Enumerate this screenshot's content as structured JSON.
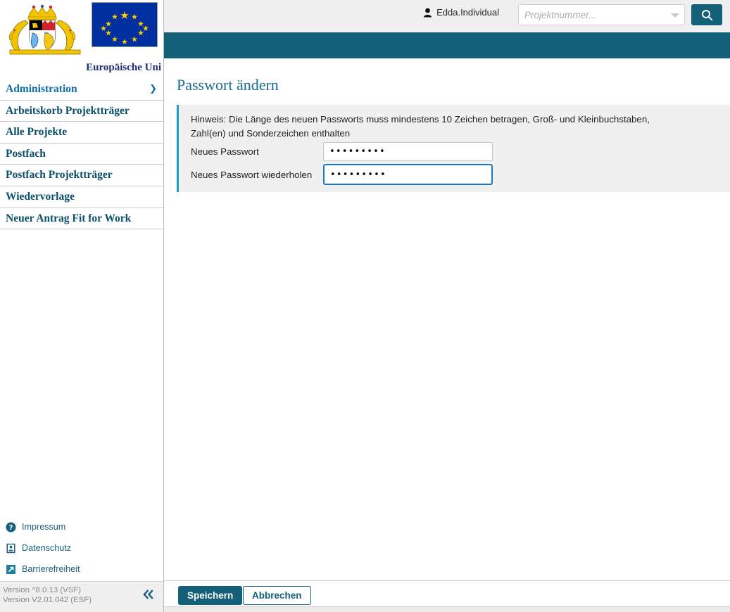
{
  "branding": {
    "bavaria_logo_alt": "bavaria-coat-of-arms",
    "eu_flag_alt": "eu-flag",
    "eu_label": "Europäische Uni"
  },
  "topbar": {
    "user_icon": "person-icon",
    "user_name": "Edda.Individual",
    "search_placeholder": "Projektnummer...",
    "search_value": "",
    "search_icon": "search-icon",
    "dropdown_icon": "chevron-down-icon"
  },
  "sidebar": {
    "items": [
      {
        "label": "Administration",
        "has_chevron": true,
        "chevron_icon": "chevron-right-icon"
      },
      {
        "label": "Arbeitskorb Projektträger",
        "has_chevron": false
      },
      {
        "label": "Alle Projekte",
        "has_chevron": false
      },
      {
        "label": "Postfach",
        "has_chevron": false
      },
      {
        "label": "Postfach Projektträger",
        "has_chevron": false
      },
      {
        "label": "Wiedervorlage",
        "has_chevron": false
      },
      {
        "label": "Neuer Antrag Fit for Work",
        "has_chevron": false
      }
    ],
    "footer_links": [
      {
        "label": "Impressum",
        "icon": "help-circle-icon"
      },
      {
        "label": "Datenschutz",
        "icon": "privacy-badge-icon"
      },
      {
        "label": "Barrierefreiheit",
        "icon": "external-link-icon"
      }
    ],
    "version_line_1": "Version ^8.0.13 (VSF)",
    "version_line_2": "Version V2.01.042 (ESF)",
    "collapse_icon": "chevron-double-left-icon"
  },
  "main": {
    "page_title": "Passwort ändern",
    "hint": "Hinweis: Die Länge des neuen Passworts muss mindestens 10 Zeichen betragen, Groß- und Kleinbuchstaben, Zahl(en) und Sonderzeichen enthalten",
    "fields": [
      {
        "label": "Neues Passwort",
        "value": "•••••••••",
        "focused": false
      },
      {
        "label": "Neues Passwort wiederholen",
        "value": "•••••••••",
        "focused": true
      }
    ]
  },
  "actions": {
    "save_label": "Speichern",
    "cancel_label": "Abbrechen"
  },
  "colors": {
    "teal": "#156079",
    "accent_cyan": "#1b9dc4",
    "link_blue": "#1b5e7e",
    "focus_blue": "#1a7ad4",
    "panel_gray": "#f0f0f0"
  }
}
